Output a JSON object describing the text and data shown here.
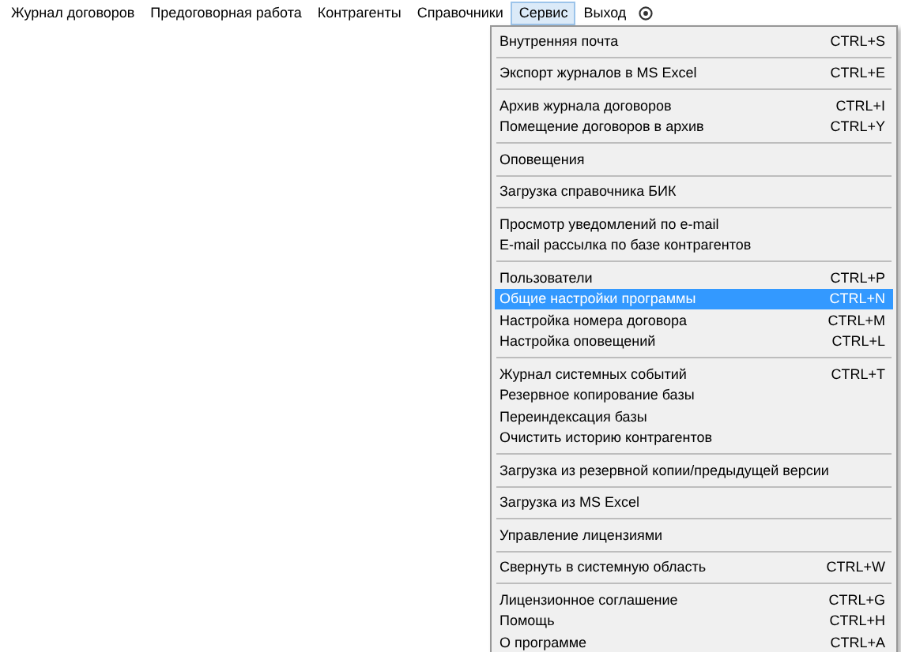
{
  "menubar": [
    {
      "label": "Журнал договоров",
      "selected": false
    },
    {
      "label": "Предоговорная работа",
      "selected": false
    },
    {
      "label": "Контрагенты",
      "selected": false
    },
    {
      "label": "Справочники",
      "selected": false
    },
    {
      "label": "Сервис",
      "selected": true
    },
    {
      "label": "Выход",
      "selected": false
    }
  ],
  "menu": {
    "groups": [
      [
        {
          "label": "Внутренняя почта",
          "shortcut": "CTRL+S",
          "selected": false
        }
      ],
      [
        {
          "label": "Экспорт журналов в MS Excel",
          "shortcut": "CTRL+E",
          "selected": false
        }
      ],
      [
        {
          "label": "Архив журнала договоров",
          "shortcut": "CTRL+I",
          "selected": false
        },
        {
          "label": "Помещение договоров в архив",
          "shortcut": "CTRL+Y",
          "selected": false
        }
      ],
      [
        {
          "label": "Оповещения",
          "selected": false
        }
      ],
      [
        {
          "label": "Загрузка справочника БИК",
          "selected": false
        }
      ],
      [
        {
          "label": "Просмотр уведомлений по e-mail",
          "selected": false
        },
        {
          "label": "E-mail рассылка по базе контрагентов",
          "selected": false
        }
      ],
      [
        {
          "label": "Пользователи",
          "shortcut": "CTRL+P",
          "selected": false
        },
        {
          "label": "Общие настройки программы",
          "shortcut": "CTRL+N",
          "selected": true
        },
        {
          "label": "Настройка номера договора",
          "shortcut": "CTRL+M",
          "selected": false
        },
        {
          "label": "Настройка оповещений",
          "shortcut": "CTRL+L",
          "selected": false
        }
      ],
      [
        {
          "label": "Журнал системных событий",
          "shortcut": "CTRL+T",
          "selected": false
        },
        {
          "label": "Резервное копирование базы",
          "selected": false
        },
        {
          "label": "Переиндексация базы",
          "selected": false
        },
        {
          "label": "Очистить историю контрагентов",
          "selected": false
        }
      ],
      [
        {
          "label": "Загрузка из резервной копии/предыдущей версии",
          "selected": false
        }
      ],
      [
        {
          "label": "Загрузка из MS Excel",
          "selected": false
        }
      ],
      [
        {
          "label": "Управление лицензиями",
          "selected": false
        }
      ],
      [
        {
          "label": "Свернуть в системную область",
          "shortcut": "CTRL+W",
          "selected": false
        }
      ],
      [
        {
          "label": "Лицензионное соглашение",
          "shortcut": "CTRL+G",
          "selected": false
        },
        {
          "label": "Помощь",
          "shortcut": "CTRL+H",
          "selected": false
        },
        {
          "label": "О программе",
          "shortcut": "CTRL+A",
          "selected": false
        }
      ]
    ]
  }
}
